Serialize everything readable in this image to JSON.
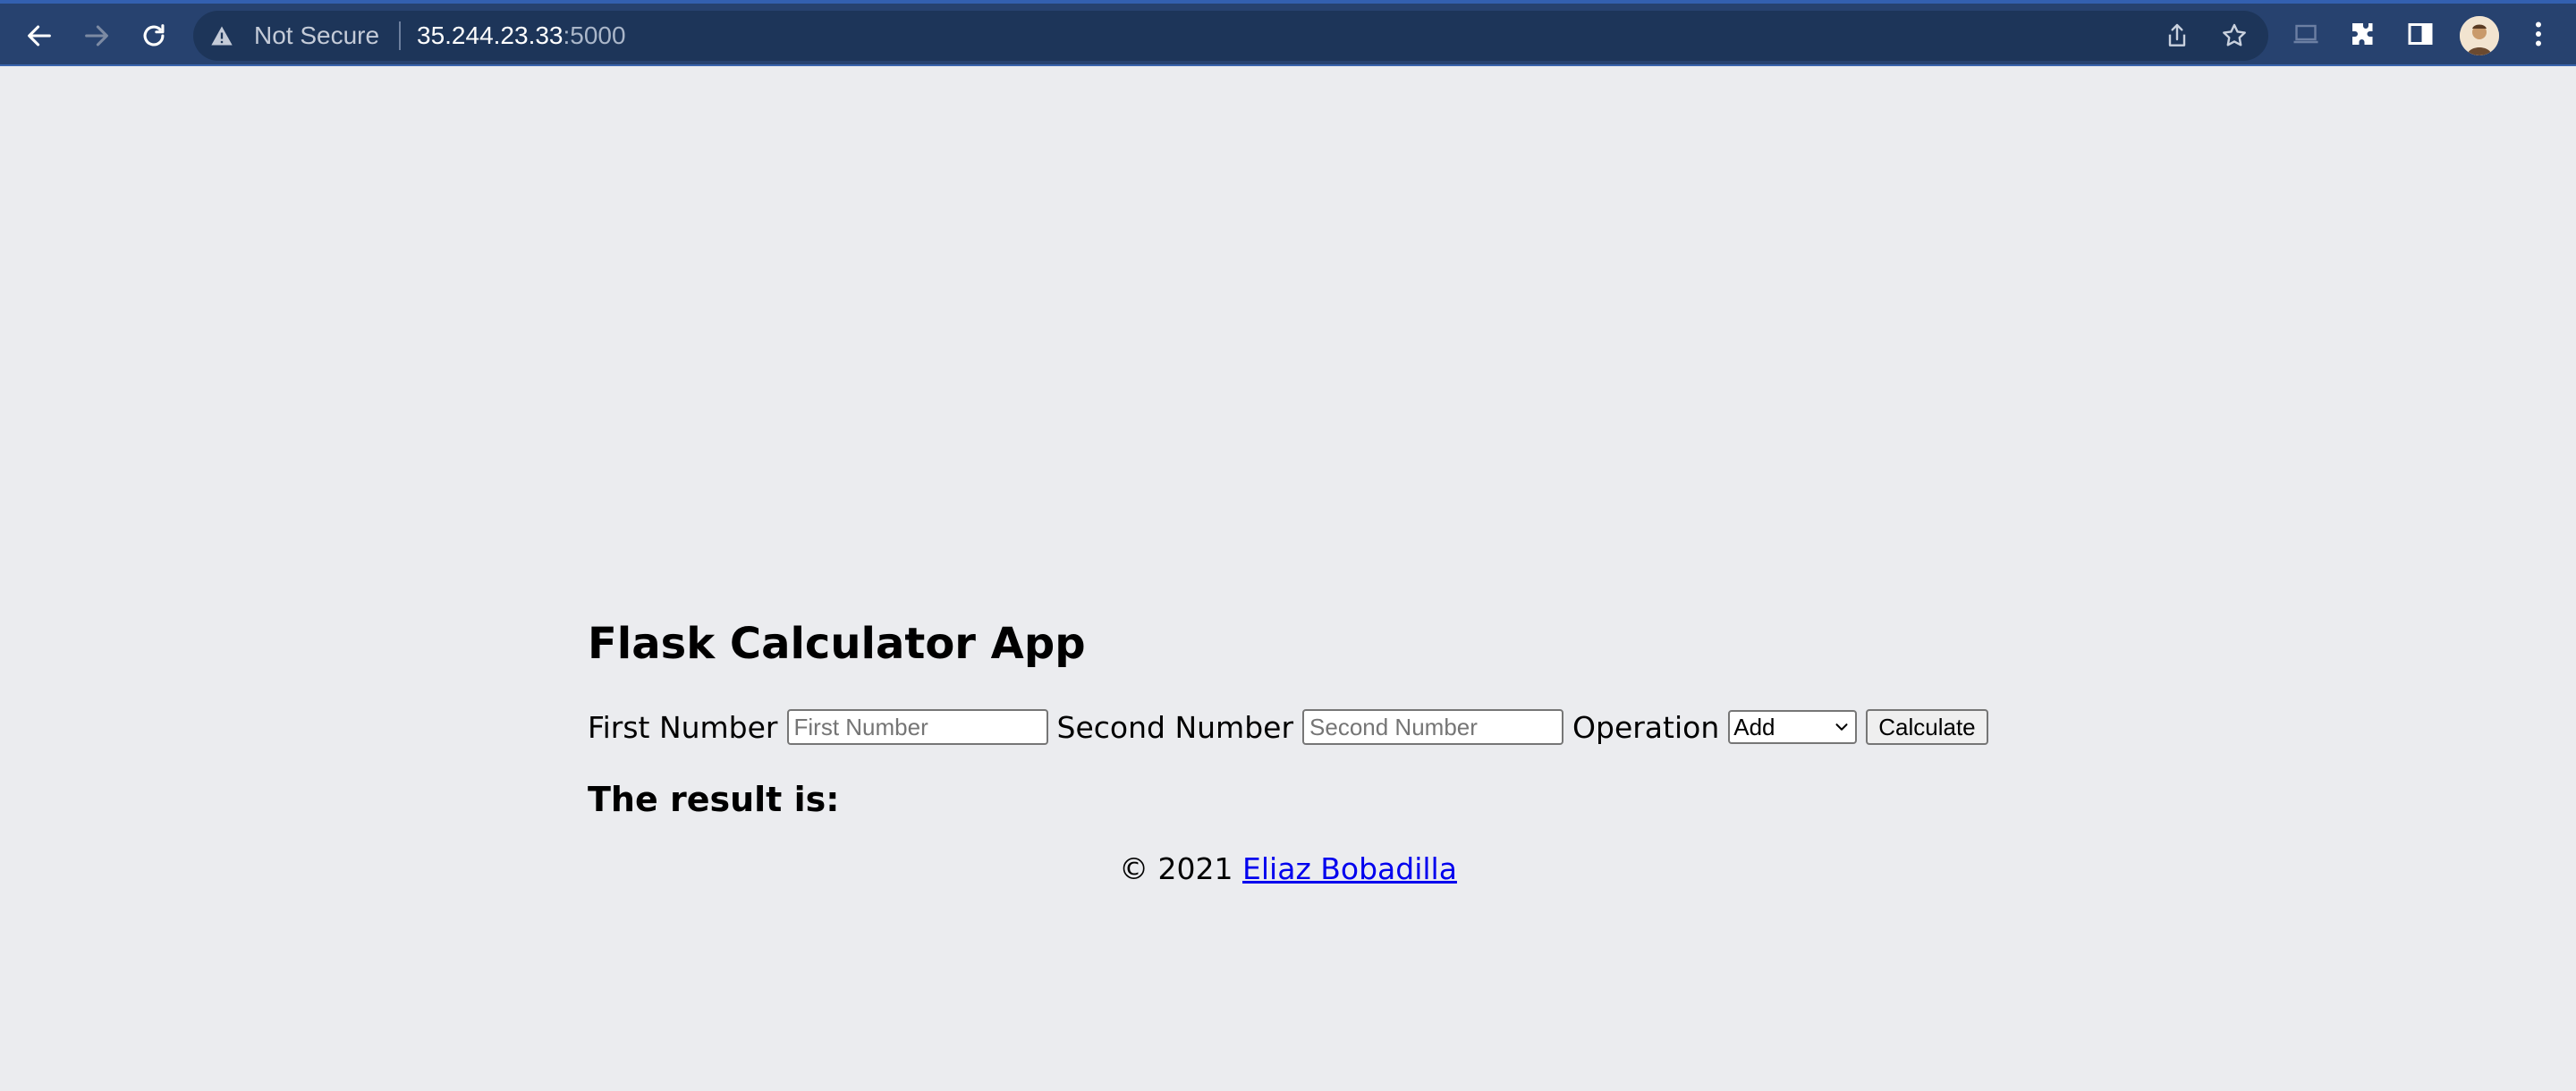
{
  "browser": {
    "security_status": "Not Secure",
    "url_host": "35.244.23.33",
    "url_port": ":5000"
  },
  "page": {
    "title": "Flask Calculator App",
    "form": {
      "first_label": "First Number",
      "first_placeholder": "First Number",
      "second_label": "Second Number",
      "second_placeholder": "Second Number",
      "operation_label": "Operation",
      "operation_selected": "Add",
      "calculate_label": "Calculate"
    },
    "result_label": "The result is:",
    "footer": {
      "copyright": "© 2021 ",
      "author_link": "Eliaz Bobadilla"
    }
  }
}
